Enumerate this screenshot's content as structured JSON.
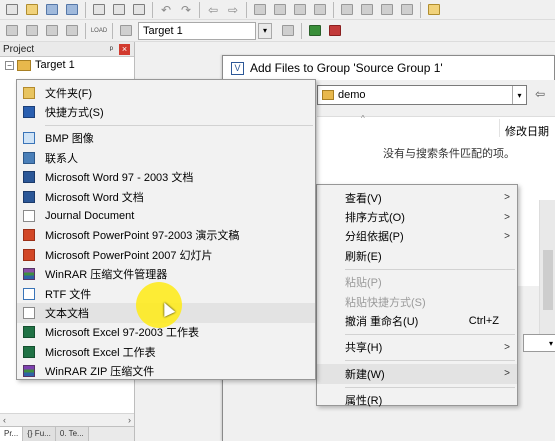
{
  "toolbar": {
    "target_value": "Target 1",
    "load_label": "LOAD"
  },
  "project_panel": {
    "title": "Project",
    "pin": "ᵖ",
    "close": "×",
    "tree_root": "Target 1",
    "tabs": [
      "Pr...",
      "{} Fu...",
      "0. Te..."
    ]
  },
  "dialog": {
    "title": "Add Files to Group 'Source Group 1'",
    "look_in": "demo",
    "column_modified": "修改日期",
    "empty_message": "没有与搜索条件匹配的项。"
  },
  "new_submenu": {
    "items": [
      {
        "label": "文件夹(F)",
        "icon": "folder-icon"
      },
      {
        "label": "快捷方式(S)",
        "icon": "shortcut-icon"
      },
      {
        "sep": true
      },
      {
        "label": "BMP 图像",
        "icon": "bmp-image-icon"
      },
      {
        "label": "联系人",
        "icon": "contact-icon"
      },
      {
        "label": "Microsoft Word 97 - 2003 文档",
        "icon": "word-icon"
      },
      {
        "label": "Microsoft Word 文档",
        "icon": "word-icon"
      },
      {
        "label": "Journal Document",
        "icon": "journal-icon"
      },
      {
        "label": "Microsoft PowerPoint 97-2003 演示文稿",
        "icon": "powerpoint-icon"
      },
      {
        "label": "Microsoft PowerPoint 2007 幻灯片",
        "icon": "powerpoint-icon"
      },
      {
        "label": "WinRAR 压缩文件管理器",
        "icon": "winrar-icon"
      },
      {
        "label": "RTF 文件",
        "icon": "rtf-icon"
      },
      {
        "label": "文本文档",
        "icon": "text-document-icon",
        "highlighted": true
      },
      {
        "label": "Microsoft Excel 97-2003 工作表",
        "icon": "excel-icon"
      },
      {
        "label": "Microsoft Excel 工作表",
        "icon": "excel-icon"
      },
      {
        "label": "WinRAR ZIP 压缩文件",
        "icon": "winrar-zip-icon"
      }
    ]
  },
  "context_menu": {
    "items": [
      {
        "label": "查看(V)",
        "submenu": true
      },
      {
        "label": "排序方式(O)",
        "submenu": true
      },
      {
        "label": "分组依据(P)",
        "submenu": true
      },
      {
        "label": "刷新(E)"
      },
      {
        "sep": true
      },
      {
        "label": "粘贴(P)",
        "disabled": true
      },
      {
        "label": "粘贴快捷方式(S)",
        "disabled": true
      },
      {
        "label": "撤消 重命名(U)",
        "shortcut": "Ctrl+Z"
      },
      {
        "sep": true
      },
      {
        "label": "共享(H)",
        "submenu": true
      },
      {
        "sep": true
      },
      {
        "label": "新建(W)",
        "submenu": true,
        "highlighted": true
      },
      {
        "sep": true
      },
      {
        "label": "属性(R)"
      }
    ]
  }
}
